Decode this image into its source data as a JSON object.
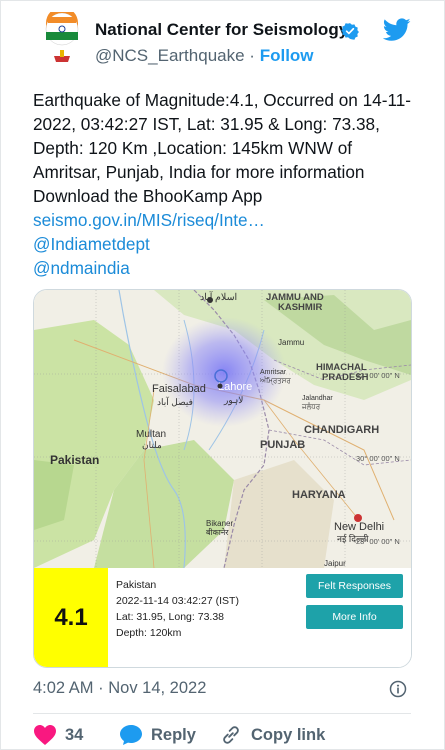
{
  "account": {
    "name": "National Center for Seismology",
    "handle": "@NCS_Earthquake",
    "separator": "·",
    "follow_label": "Follow"
  },
  "icons": {
    "avatar": "ncs-logo",
    "verified": "verified-badge-icon",
    "brand": "twitter-bird-icon",
    "info": "info-circle-icon",
    "like": "heart-icon",
    "reply": "speech-bubble-icon",
    "copy_link": "link-icon"
  },
  "tweet": {
    "text": "Earthquake of Magnitude:4.1, Occurred on 14-11-2022, 03:42:27 IST, Lat: 31.95 & Long: 73.38, Depth: 120 Km ,Location: 145km WNW of Amritsar, Punjab, India for more information Download the BhooKamp App",
    "link": "seismo.gov.in/MIS/riseq/Inte…",
    "mentions": [
      "@Indiametdept",
      "@ndmaindia"
    ]
  },
  "map": {
    "labels": {
      "islamabad": "اسلام آباد",
      "jk": "JAMMU AND",
      "jk2": "KASHMIR",
      "jammu": "Jammu",
      "himachal": "HIMACHAL",
      "himachal2": "PRADESH",
      "amritsar": "Amritsar",
      "amritsar_local": "ਅੰਮ੍ਰਿਤਸਰ",
      "faisalabad": "Faisalabad",
      "faisalabad_local": "فیصل آباد",
      "lahore": "Lahore",
      "lahore_local": "لاہور",
      "jalandhar": "Jalandhar",
      "jalandhar_local": "ਜਲੰਧਰ",
      "multan": "Multan",
      "multan_local": "ملتان",
      "chandigarh": "CHANDIGARH",
      "punjab": "PUNJAB",
      "pakistan": "Pakistan",
      "haryana": "HARYANA",
      "bikaner": "Bikaner",
      "bikaner_local": "बीकानेर",
      "newdelhi": "New Delhi",
      "newdelhi_local": "नई दिल्ली",
      "jaipur": "Jaipur"
    },
    "gridlines": [
      "32° 00' 00\" N",
      "30° 00' 00\" N",
      "28° 00' 00\" N"
    ]
  },
  "quake_card": {
    "magnitude": "4.1",
    "region": "Pakistan",
    "datetime": "2022-11-14 03:42:27 (IST)",
    "coords": "Lat: 31.95, Long: 73.38",
    "depth": "Depth: 120km",
    "felt_button": "Felt Responses",
    "more_button": "More Info"
  },
  "meta": {
    "time": "4:02 AM",
    "separator": "·",
    "date": "Nov 14, 2022"
  },
  "actions": {
    "likes": "34",
    "reply": "Reply",
    "copy_link": "Copy link"
  },
  "colors": {
    "accent": "#1d9bf0",
    "like": "#f91880",
    "magnitude_bg": "#ffff00",
    "button": "#1ea2a9"
  }
}
